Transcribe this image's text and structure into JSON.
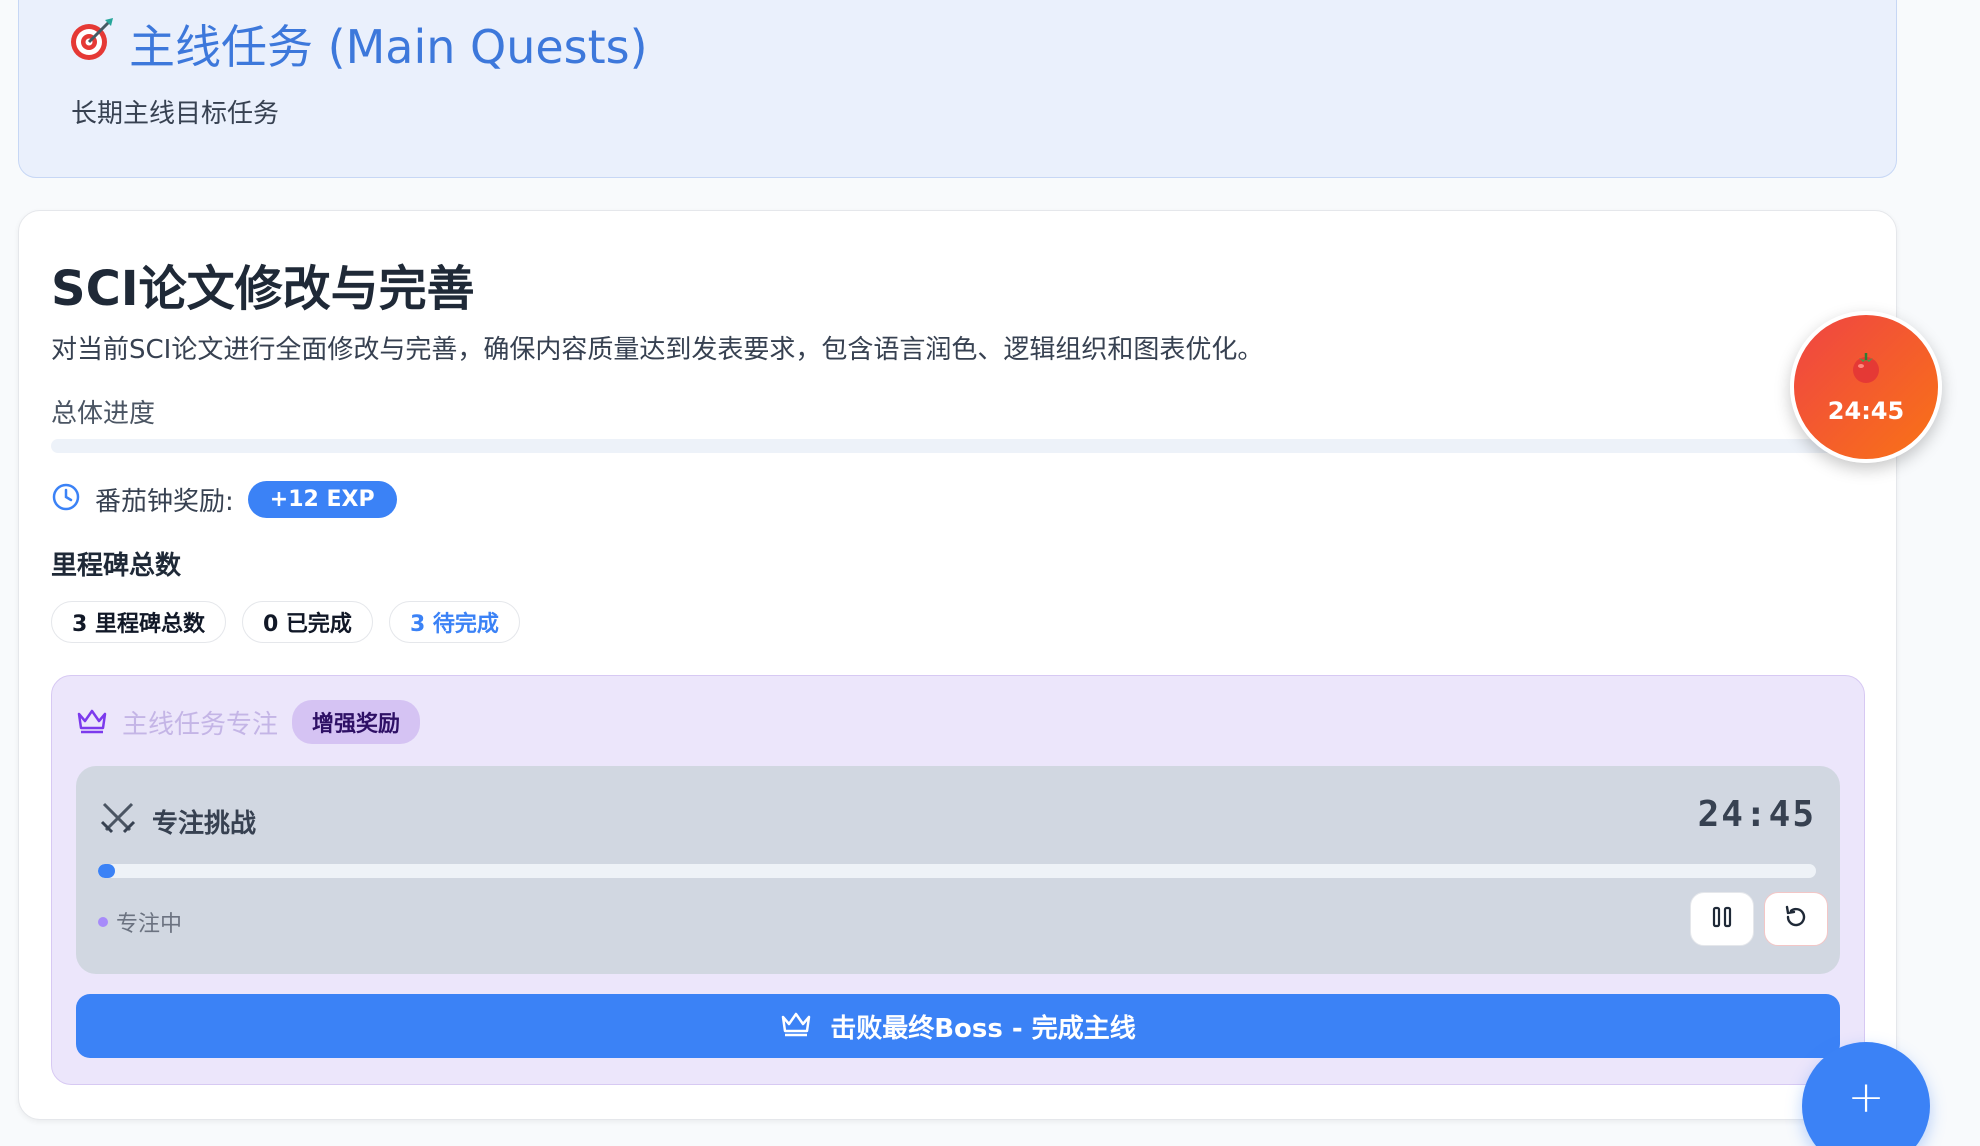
{
  "header": {
    "title": "主线任务 (Main Quests)",
    "subtitle": "长期主线目标任务",
    "icon": "target-icon"
  },
  "quest": {
    "title": "SCI论文修改与完善",
    "description": "对当前SCI论文进行全面修改与完善，确保内容质量达到发表要求，包含语言润色、逻辑组织和图表优化。",
    "progress_label": "总体进度",
    "progress_value": 0,
    "reward_label": "番茄钟奖励:",
    "reward_badge": "+12 EXP",
    "milestones_title": "里程碑总数",
    "milestones": {
      "total": "3 里程碑总数",
      "done": "0 已完成",
      "pending": "3 待完成"
    }
  },
  "focus": {
    "label": "主线任务专注",
    "boost_badge": "增强奖励",
    "challenge_label": "专注挑战",
    "timer": "24:45",
    "timer_progress": 0.01,
    "status": "专注中",
    "boss_button": "击败最终Boss - 完成主线"
  },
  "tomato_timer": {
    "time": "24:45",
    "icon": "tomato-icon"
  },
  "fab": {
    "label": "+"
  },
  "colors": {
    "accent": "#3b82f6",
    "title_blue": "#3d78db",
    "header_bg": "#eaf0fc",
    "focus_bg": "#ece6fb",
    "tomato_start": "#ef4444",
    "tomato_end": "#f97316"
  }
}
